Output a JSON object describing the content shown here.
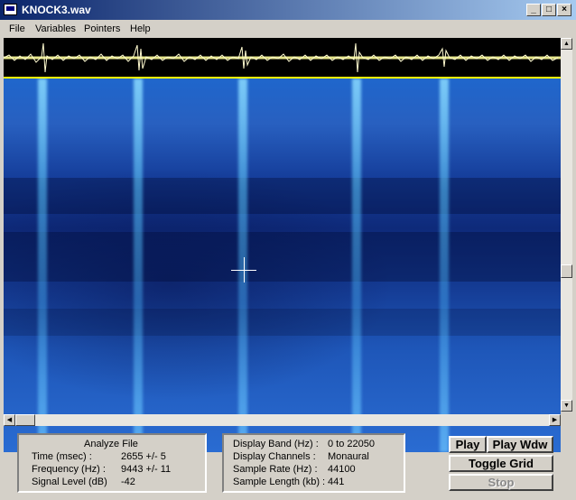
{
  "window": {
    "title": "KNOCK3.wav"
  },
  "menu": [
    "File",
    "Variables",
    "Pointers",
    "Help"
  ],
  "analyze": {
    "heading": "Analyze File",
    "rows": [
      {
        "label": "Time (msec) :",
        "value": "2655 +/- 5"
      },
      {
        "label": "Frequency (Hz) :",
        "value": "9443 +/- 11"
      },
      {
        "label": "Signal Level (dB)",
        "value": "-42"
      }
    ]
  },
  "display": {
    "rows": [
      {
        "label": "Display Band (Hz) :",
        "value": "0 to 22050"
      },
      {
        "label": "Display Channels :",
        "value": "Monaural"
      },
      {
        "label": "Sample Rate (Hz) :",
        "value": "44100"
      },
      {
        "label": "Sample Length (kb) :",
        "value": "441"
      }
    ]
  },
  "buttons": {
    "play": "Play",
    "play_wdw": "Play Wdw",
    "toggle_grid": "Toggle Grid",
    "stop": "Stop"
  },
  "colors": {
    "title_active": "#0a246a",
    "spectrogram_base": "#1e56b8",
    "waveform": "#ffff99"
  }
}
